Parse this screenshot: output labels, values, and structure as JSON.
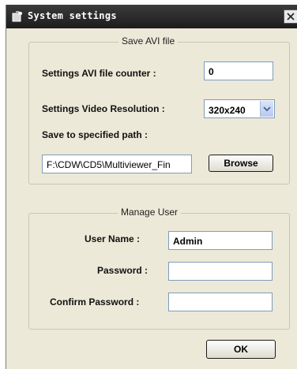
{
  "window": {
    "title": "System settings"
  },
  "save_avi": {
    "group_title": "Save AVI file",
    "counter_label": "Settings AVI file counter :",
    "counter_value": "0",
    "resolution_label": "Settings Video Resolution :",
    "resolution_value": "320x240",
    "path_label": "Save to specified path :",
    "path_value": "F:\\CDW\\CD5\\Multiviewer_Fin",
    "browse_label": "Browse"
  },
  "manage_user": {
    "group_title": "Manage User",
    "username_label": "User Name :",
    "username_value": "Admin",
    "password_label": "Password :",
    "password_value": "",
    "confirm_label": "Confirm Password :",
    "confirm_value": ""
  },
  "footer": {
    "ok_label": "OK"
  },
  "icons": {
    "title": "app-icon",
    "close": "close-icon",
    "dropdown": "chevron-down-icon"
  },
  "colors": {
    "titlebar": "#2a2a2a",
    "dialog_bg": "#ece9d8",
    "input_border": "#7f9db9"
  }
}
